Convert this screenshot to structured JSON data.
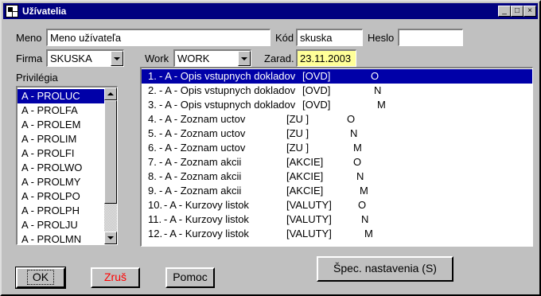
{
  "window": {
    "title": "Užívatelia",
    "minimize": "_",
    "maximize": "□",
    "close": "×"
  },
  "form": {
    "meno_label": "Meno",
    "meno_value": "Meno užívateľa",
    "kod_label": "Kód",
    "kod_value": "skuska",
    "heslo_label": "Heslo",
    "heslo_value": "",
    "firma_label": "Firma",
    "firma_value": "SKUSKA",
    "work_label": "Work",
    "work_value": "WORK",
    "zarad_label": "Zarad.",
    "zarad_value": "23.11.2003"
  },
  "privileges": {
    "label": "Privilégia",
    "items": [
      "A - PROLUC",
      "A - PROLFA",
      "A - PROLEM",
      "A - PROLIM",
      "A - PROLFI",
      "A - PROLWO",
      "A - PROLMY",
      "A - PROLPO",
      "A - PROLPH",
      "A - PROLJU",
      "A - PROLMN"
    ],
    "selected_index": 0
  },
  "permissions": {
    "selected_index": 0,
    "rows": [
      {
        "num": "1.",
        "name": "- A - Opis vstupnych dokladov",
        "code": "[OVD]",
        "level": "O"
      },
      {
        "num": "2.",
        "name": "- A - Opis vstupnych dokladov",
        "code": "[OVD]",
        "level": "N"
      },
      {
        "num": "3.",
        "name": "- A - Opis vstupnych dokladov",
        "code": "[OVD]",
        "level": "M"
      },
      {
        "num": "4.",
        "name": "- A - Zoznam uctov",
        "code": "[ZU ]",
        "level": "O"
      },
      {
        "num": "5.",
        "name": "- A - Zoznam uctov",
        "code": "[ZU ]",
        "level": "N"
      },
      {
        "num": "6.",
        "name": "- A - Zoznam uctov",
        "code": "[ZU ]",
        "level": "M"
      },
      {
        "num": "7.",
        "name": "- A - Zoznam akcii",
        "code": "[AKCIE]",
        "level": "O"
      },
      {
        "num": "8.",
        "name": "- A - Zoznam akcii",
        "code": "[AKCIE]",
        "level": "N"
      },
      {
        "num": "9.",
        "name": "- A - Zoznam akcii",
        "code": "[AKCIE]",
        "level": "M"
      },
      {
        "num": "10.",
        "name": "- A - Kurzovy listok",
        "code": "[VALUTY]",
        "level": "O"
      },
      {
        "num": "11.",
        "name": "- A - Kurzovy listok",
        "code": "[VALUTY]",
        "level": "N"
      },
      {
        "num": "12.",
        "name": "- A - Kurzovy listok",
        "code": "[VALUTY]",
        "level": "M"
      }
    ]
  },
  "buttons": {
    "ok": "OK",
    "cancel": "Zruš",
    "help": "Pomoc",
    "special": "Špec. nastavenia (S)"
  },
  "colors": {
    "title_bar": "#000080",
    "selection": "#0000a8",
    "cancel_text": "#ff0000",
    "date_bg": "#ffff99",
    "face": "#c0c0c0"
  }
}
